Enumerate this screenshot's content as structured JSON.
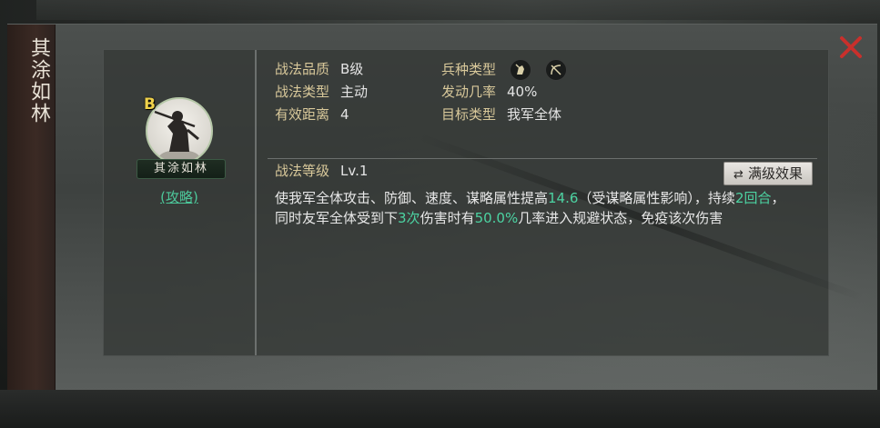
{
  "dialog": {
    "title": "其涂如林"
  },
  "skill": {
    "grade": "B",
    "name": "其涂如林",
    "guide_link": "(攻略)",
    "quality_label": "战法品质",
    "quality_value": "B级",
    "type_label": "战法类型",
    "type_value": "主动",
    "range_label": "有效距离",
    "range_value": "4",
    "unit_type_label": "兵种类型",
    "unit_type_icons": [
      "cavalry-icon",
      "archer-icon"
    ],
    "trigger_label": "发动几率",
    "trigger_value": "40%",
    "target_label": "目标类型",
    "target_value": "我军全体",
    "level_label": "战法等级",
    "level_value": "Lv.1",
    "max_button_label": "满级效果",
    "max_button_icon": "swap-arrows-icon",
    "description": {
      "p1": "使我军全体攻击、防御、速度、谋略属性提高",
      "v1": "14.6",
      "p2": "（受谋略属性影响），持续",
      "v2": "2回合",
      "p3": "，",
      "p4": "同时友军全体受到下",
      "v3": "3次",
      "p5": "伤害时有",
      "v4": "50.0%",
      "p6": "几率进入规避状态，免疫该次伤害"
    }
  },
  "colors": {
    "label": "#d8c89a",
    "highlight": "#4cd3a2",
    "grade": "#f0d24a",
    "close": "#c9302c",
    "link": "#4cc79a"
  }
}
